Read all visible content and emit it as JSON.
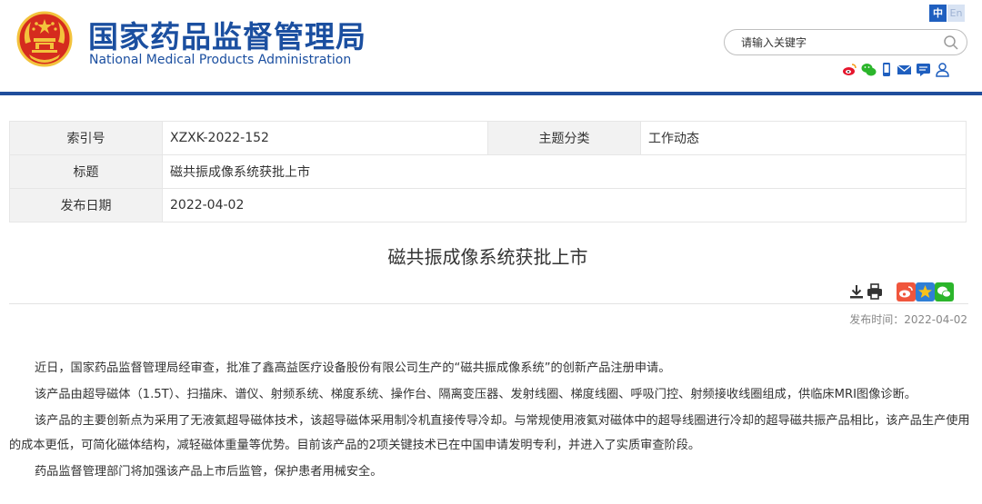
{
  "header": {
    "title_cn": "国家药品监督管理局",
    "title_en": "National Medical Products Administration",
    "lang_zh": "中",
    "lang_en": "En",
    "search_placeholder": "请输入关键字"
  },
  "colors": {
    "brand_blue": "#1b4fa0",
    "header_rule": "#1f4e9c",
    "emblem_red": "#d52b1e",
    "emblem_gold": "#f3c33c"
  },
  "social_icons": [
    "weibo-icon",
    "wechat-icon",
    "mobile-icon",
    "mail-icon",
    "message-icon",
    "user-icon"
  ],
  "info": {
    "index_label": "索引号",
    "index_value": "XZXK-2022-152",
    "category_label": "主题分类",
    "category_value": "工作动态",
    "title_label": "标题",
    "title_value": "磁共振成像系统获批上市",
    "date_label": "发布日期",
    "date_value": "2022-04-02"
  },
  "article": {
    "title": "磁共振成像系统获批上市",
    "pubtime": "发布时间：2022-04-02",
    "paragraphs": [
      "近日，国家药品监督管理局经审查，批准了鑫高益医疗设备股份有限公司生产的“磁共振成像系统”的创新产品注册申请。",
      "该产品由超导磁体（1.5T）、扫描床、谱仪、射频系统、梯度系统、操作台、隔离变压器、发射线圈、梯度线圈、呼吸门控、射频接收线圈组成，供临床MRI图像诊断。",
      "该产品的主要创新点为采用了无液氦超导磁体技术，该超导磁体采用制冷机直接传导冷却。与常规使用液氦对磁体中的超导线圈进行冷却的超导磁共振产品相比，该产品生产使用的成本更低，可简化磁体结构，减轻磁体重量等优势。目前该产品的2项关键技术已在中国申请发明专利，并进入了实质审查阶段。",
      "药品监督管理部门将加强该产品上市后监管，保护患者用械安全。"
    ]
  },
  "tools": [
    "download-icon",
    "print-icon",
    "weibo-share-icon",
    "qzone-share-icon",
    "wechat-share-icon"
  ]
}
